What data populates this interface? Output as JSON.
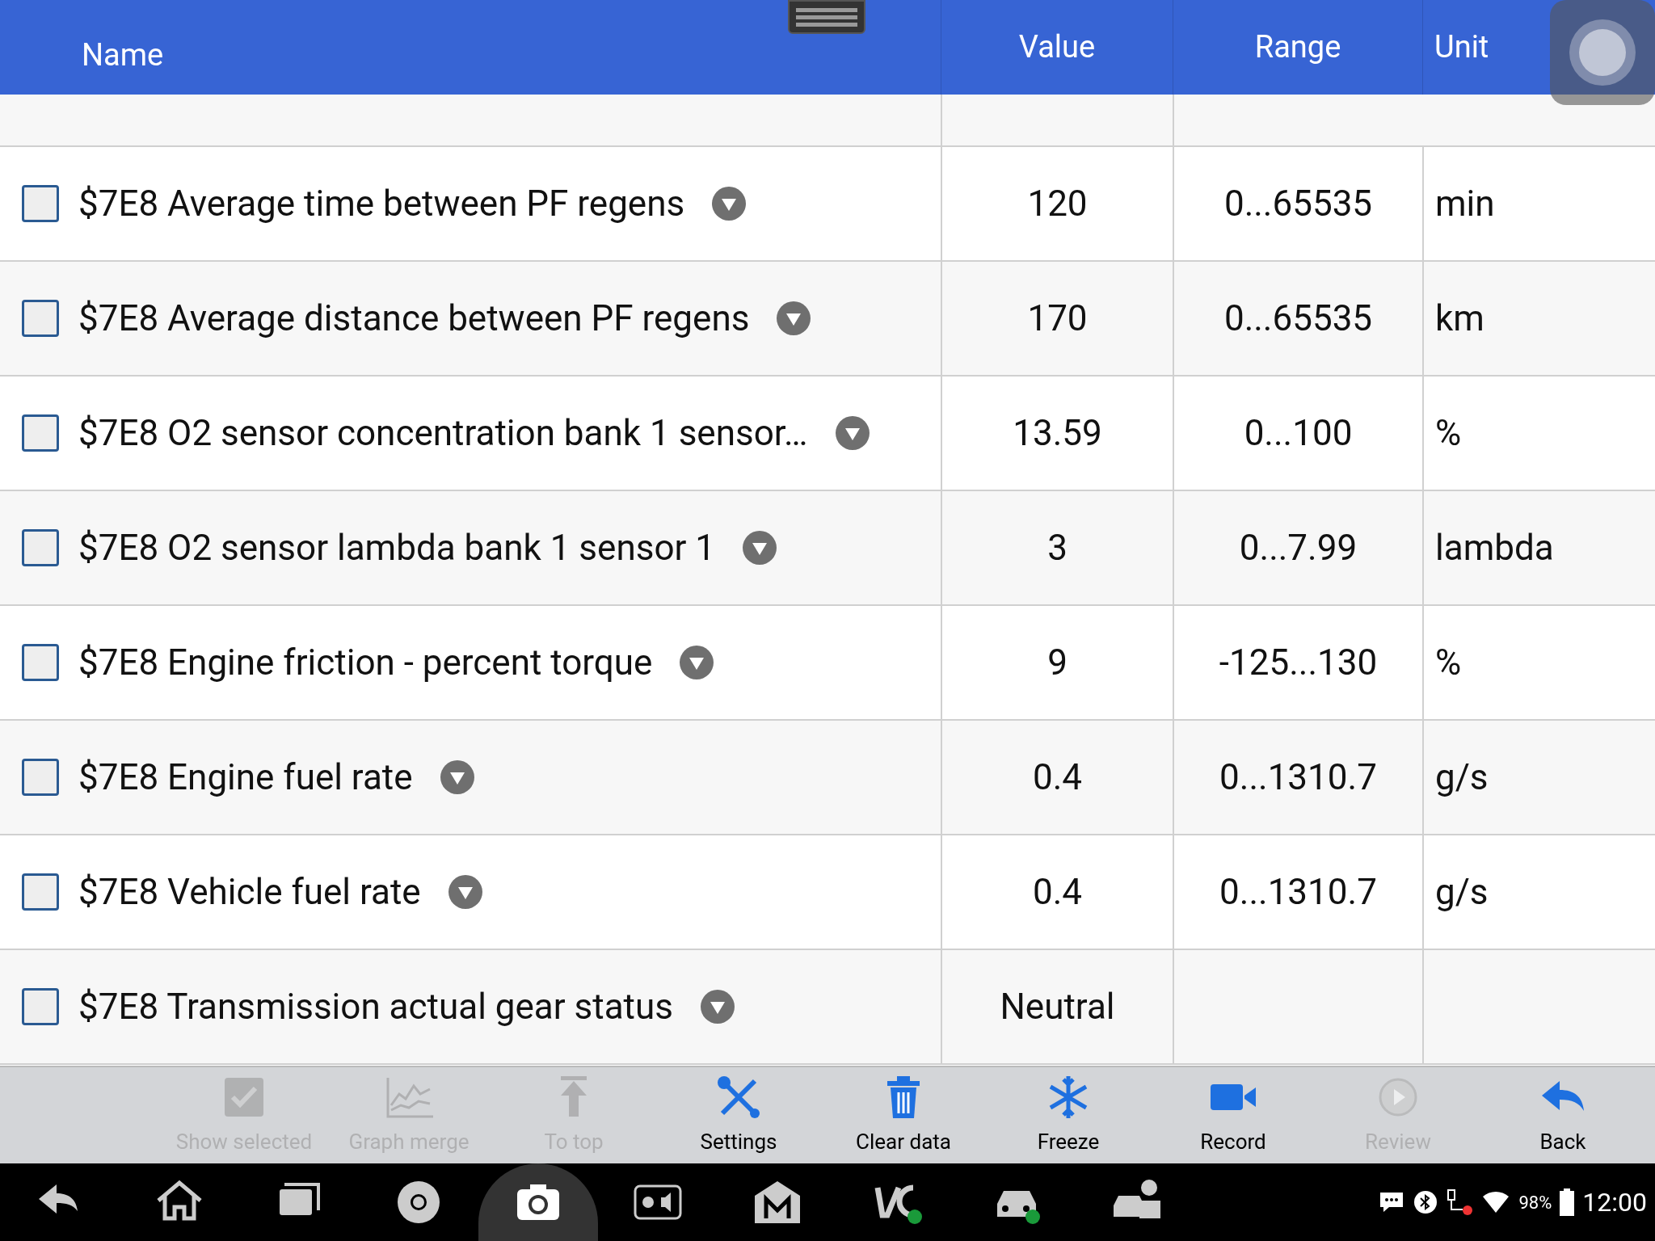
{
  "table": {
    "columns": [
      "Name",
      "Value",
      "Range",
      "Unit"
    ],
    "rows": [
      {
        "name": "$7E8 Average time between PF regens",
        "value": "120",
        "range": "0...65535",
        "unit": "min",
        "checked": false
      },
      {
        "name": "$7E8 Average distance between PF regens",
        "value": "170",
        "range": "0...65535",
        "unit": "km",
        "checked": false
      },
      {
        "name": "$7E8 O2 sensor concentration bank 1 sensor…",
        "value": "13.59",
        "range": "0...100",
        "unit": "%",
        "checked": false
      },
      {
        "name": "$7E8 O2 sensor lambda bank 1 sensor 1",
        "value": "3",
        "range": "0...7.99",
        "unit": "lambda",
        "checked": false
      },
      {
        "name": "$7E8 Engine friction - percent torque",
        "value": "9",
        "range": "-125...130",
        "unit": "%",
        "checked": false
      },
      {
        "name": "$7E8 Engine fuel rate",
        "value": "0.4",
        "range": "0...1310.7",
        "unit": "g/s",
        "checked": false
      },
      {
        "name": "$7E8 Vehicle fuel rate",
        "value": "0.4",
        "range": "0...1310.7",
        "unit": "g/s",
        "checked": false
      },
      {
        "name": "$7E8 Transmission actual gear status",
        "value": "Neutral",
        "checked": false
      }
    ]
  },
  "toolbar": [
    {
      "kind": "check",
      "label": "Show selected",
      "disabled": true
    },
    {
      "kind": "graph",
      "label": "Graph merge",
      "disabled": true
    },
    {
      "kind": "totop",
      "label": "To top",
      "disabled": true
    },
    {
      "kind": "settings",
      "label": "Settings",
      "disabled": false
    },
    {
      "kind": "trash",
      "label": "Clear data",
      "disabled": false
    },
    {
      "kind": "freeze",
      "label": "Freeze",
      "disabled": false
    },
    {
      "kind": "record",
      "label": "Record",
      "disabled": false
    },
    {
      "kind": "review",
      "label": "Review",
      "disabled": true
    },
    {
      "kind": "back",
      "label": "Back",
      "disabled": false
    }
  ],
  "status_bar": {
    "battery": "98%",
    "time": "12:00"
  }
}
